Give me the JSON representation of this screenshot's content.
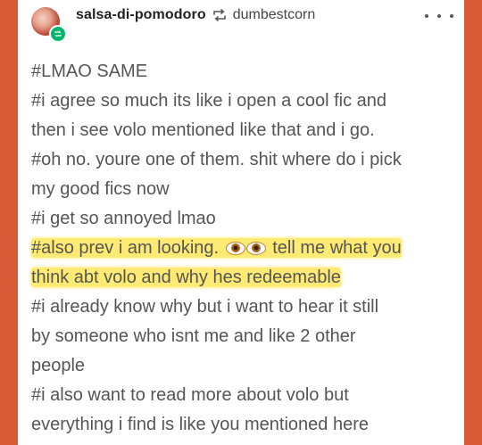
{
  "post": {
    "author": "salsa-di-pomodoro",
    "reblogged_from": "dumbestcorn",
    "more_menu_icon": "more-dots-icon",
    "reblog_icon": "reblog-icon"
  },
  "tags": {
    "line1": "#LMAO SAME",
    "line2": "#i agree so much its like i open a cool fic and",
    "line3": "then i see volo mentioned like that and i go.",
    "line4": "#oh no. youre one of them. shit where do i pick",
    "line5": "my good fics now",
    "line6": "#i get so annoyed lmao",
    "line7_before": "#also prev i am looking.",
    "line7_emoji": "👀",
    "line7_after": "tell me what you",
    "line8": "think abt volo and why hes redeemable",
    "line9": "#i already know why but i want to hear it still",
    "line10": "by someone who isnt me and like 2 other",
    "line11": "people",
    "line12": "#i also want to read more about volo but",
    "line13": "everything i find is like you mentioned here"
  },
  "colors": {
    "background": "#d95a36",
    "card": "#ffffff",
    "highlight": "#ffe85a",
    "reblog_badge": "#01b66b"
  }
}
